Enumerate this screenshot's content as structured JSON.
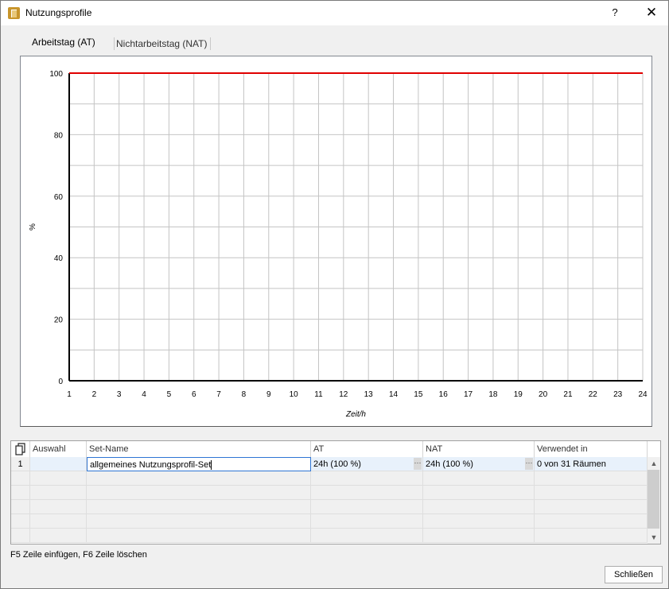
{
  "window": {
    "title": "Nutzungsprofile",
    "help_label": "?",
    "close_label": "✕"
  },
  "tabs": [
    {
      "label": "Arbeitstag (AT)",
      "active": true
    },
    {
      "label": "Nichtarbeitstag (NAT)",
      "active": false
    }
  ],
  "chart_data": {
    "type": "line",
    "xlabel": "Zeit/h",
    "ylabel": "%",
    "xlim": [
      1,
      24
    ],
    "ylim": [
      0,
      100
    ],
    "x_ticks": [
      1,
      2,
      3,
      4,
      5,
      6,
      7,
      8,
      9,
      10,
      11,
      12,
      13,
      14,
      15,
      16,
      17,
      18,
      19,
      20,
      21,
      22,
      23,
      24
    ],
    "y_ticks": [
      0,
      20,
      40,
      60,
      80,
      100
    ],
    "grid": true,
    "series": [
      {
        "x": [
          1,
          24
        ],
        "values": [
          100,
          100
        ],
        "color": "#e00000"
      }
    ]
  },
  "grid": {
    "headers": [
      "Auswahl",
      "Set-Name",
      "AT",
      "NAT",
      "Verwendet in"
    ],
    "rows": [
      {
        "number": "1",
        "auswahl": "",
        "set_name": "allgemeines Nutzungsprofil-Set",
        "at": "24h (100 %)",
        "nat": "24h (100 %)",
        "verwendet": "0 von 31 Räumen"
      }
    ],
    "ellipsis": "···"
  },
  "footer": {
    "hint": "F5 Zeile einfügen, F6 Zeile löschen",
    "close_button": "Schließen"
  }
}
